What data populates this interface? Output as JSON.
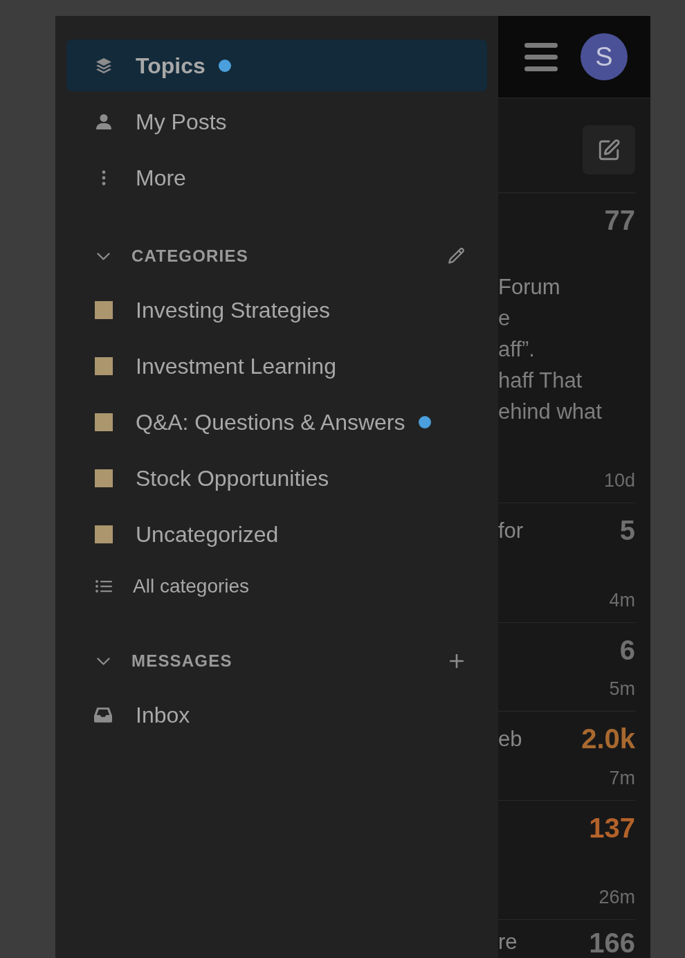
{
  "sidebar": {
    "nav": [
      {
        "kind": "topics",
        "label": "Topics",
        "selected": true,
        "unread": true
      },
      {
        "kind": "posts",
        "label": "My Posts",
        "selected": false,
        "unread": false
      },
      {
        "kind": "more",
        "label": "More",
        "selected": false,
        "unread": false
      }
    ],
    "sections": [
      {
        "kind": "edit",
        "title": "CATEGORIES",
        "expanded": true,
        "items": [
          {
            "kind": "category",
            "label": "Investing Strategies",
            "color": "#ab966e",
            "unread": false
          },
          {
            "kind": "category",
            "label": "Investment Learning",
            "color": "#ab966e",
            "unread": false
          },
          {
            "kind": "category",
            "label": "Q&A: Questions & Answers",
            "color": "#ab966e",
            "unread": true
          },
          {
            "kind": "category",
            "label": "Stock Opportunities",
            "color": "#ab966e",
            "unread": false
          },
          {
            "kind": "category",
            "label": "Uncategorized",
            "color": "#ab966e",
            "unread": false
          },
          {
            "kind": "all",
            "label": "All categories",
            "unread": false
          }
        ]
      },
      {
        "kind": "add",
        "title": "MESSAGES",
        "expanded": true,
        "items": [
          {
            "kind": "inbox",
            "label": "Inbox",
            "unread": false
          }
        ]
      }
    ]
  },
  "header": {
    "avatar": "S"
  },
  "topics": [
    {
      "title": "Forum",
      "excerpt": [
        "e",
        "aff”.",
        "haff That",
        "ehind what"
      ],
      "replies": "77",
      "color": "#707070",
      "age": "10d"
    },
    {
      "title": "for",
      "replies": "5",
      "color": "#707070",
      "age": "4m"
    },
    {
      "replies": "6",
      "color": "#707070",
      "age": "5m"
    },
    {
      "title": "eb",
      "replies": "2.0k",
      "color": "#a8692f",
      "age": "7m"
    },
    {
      "replies": "137",
      "color": "#b3622a",
      "age": "26m"
    },
    {
      "title": "re",
      "replies": "166",
      "color": "#707070"
    }
  ]
}
